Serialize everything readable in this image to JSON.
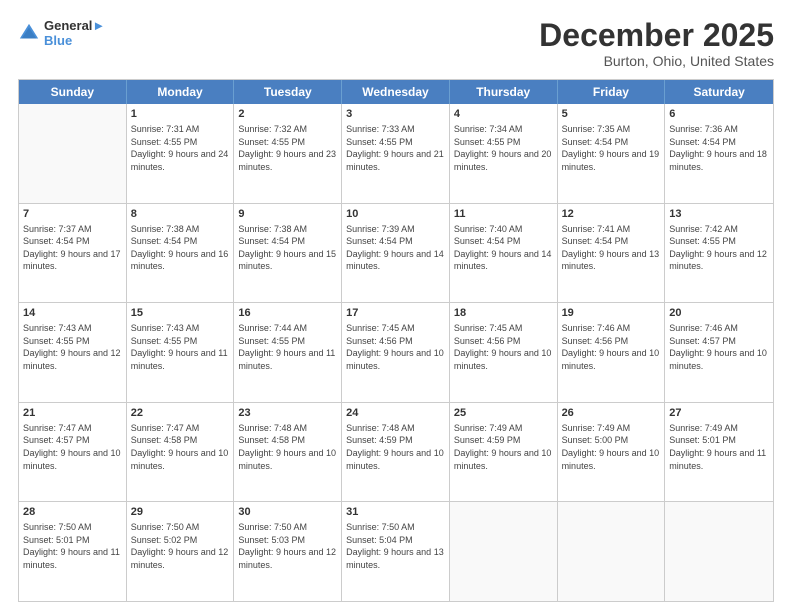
{
  "header": {
    "logo_line1": "General",
    "logo_line2": "Blue",
    "month": "December 2025",
    "location": "Burton, Ohio, United States"
  },
  "days_of_week": [
    "Sunday",
    "Monday",
    "Tuesday",
    "Wednesday",
    "Thursday",
    "Friday",
    "Saturday"
  ],
  "weeks": [
    [
      {
        "day": "",
        "sunrise": "",
        "sunset": "",
        "daylight": ""
      },
      {
        "day": "1",
        "sunrise": "Sunrise: 7:31 AM",
        "sunset": "Sunset: 4:55 PM",
        "daylight": "Daylight: 9 hours and 24 minutes."
      },
      {
        "day": "2",
        "sunrise": "Sunrise: 7:32 AM",
        "sunset": "Sunset: 4:55 PM",
        "daylight": "Daylight: 9 hours and 23 minutes."
      },
      {
        "day": "3",
        "sunrise": "Sunrise: 7:33 AM",
        "sunset": "Sunset: 4:55 PM",
        "daylight": "Daylight: 9 hours and 21 minutes."
      },
      {
        "day": "4",
        "sunrise": "Sunrise: 7:34 AM",
        "sunset": "Sunset: 4:55 PM",
        "daylight": "Daylight: 9 hours and 20 minutes."
      },
      {
        "day": "5",
        "sunrise": "Sunrise: 7:35 AM",
        "sunset": "Sunset: 4:54 PM",
        "daylight": "Daylight: 9 hours and 19 minutes."
      },
      {
        "day": "6",
        "sunrise": "Sunrise: 7:36 AM",
        "sunset": "Sunset: 4:54 PM",
        "daylight": "Daylight: 9 hours and 18 minutes."
      }
    ],
    [
      {
        "day": "7",
        "sunrise": "Sunrise: 7:37 AM",
        "sunset": "Sunset: 4:54 PM",
        "daylight": "Daylight: 9 hours and 17 minutes."
      },
      {
        "day": "8",
        "sunrise": "Sunrise: 7:38 AM",
        "sunset": "Sunset: 4:54 PM",
        "daylight": "Daylight: 9 hours and 16 minutes."
      },
      {
        "day": "9",
        "sunrise": "Sunrise: 7:38 AM",
        "sunset": "Sunset: 4:54 PM",
        "daylight": "Daylight: 9 hours and 15 minutes."
      },
      {
        "day": "10",
        "sunrise": "Sunrise: 7:39 AM",
        "sunset": "Sunset: 4:54 PM",
        "daylight": "Daylight: 9 hours and 14 minutes."
      },
      {
        "day": "11",
        "sunrise": "Sunrise: 7:40 AM",
        "sunset": "Sunset: 4:54 PM",
        "daylight": "Daylight: 9 hours and 14 minutes."
      },
      {
        "day": "12",
        "sunrise": "Sunrise: 7:41 AM",
        "sunset": "Sunset: 4:54 PM",
        "daylight": "Daylight: 9 hours and 13 minutes."
      },
      {
        "day": "13",
        "sunrise": "Sunrise: 7:42 AM",
        "sunset": "Sunset: 4:55 PM",
        "daylight": "Daylight: 9 hours and 12 minutes."
      }
    ],
    [
      {
        "day": "14",
        "sunrise": "Sunrise: 7:43 AM",
        "sunset": "Sunset: 4:55 PM",
        "daylight": "Daylight: 9 hours and 12 minutes."
      },
      {
        "day": "15",
        "sunrise": "Sunrise: 7:43 AM",
        "sunset": "Sunset: 4:55 PM",
        "daylight": "Daylight: 9 hours and 11 minutes."
      },
      {
        "day": "16",
        "sunrise": "Sunrise: 7:44 AM",
        "sunset": "Sunset: 4:55 PM",
        "daylight": "Daylight: 9 hours and 11 minutes."
      },
      {
        "day": "17",
        "sunrise": "Sunrise: 7:45 AM",
        "sunset": "Sunset: 4:56 PM",
        "daylight": "Daylight: 9 hours and 10 minutes."
      },
      {
        "day": "18",
        "sunrise": "Sunrise: 7:45 AM",
        "sunset": "Sunset: 4:56 PM",
        "daylight": "Daylight: 9 hours and 10 minutes."
      },
      {
        "day": "19",
        "sunrise": "Sunrise: 7:46 AM",
        "sunset": "Sunset: 4:56 PM",
        "daylight": "Daylight: 9 hours and 10 minutes."
      },
      {
        "day": "20",
        "sunrise": "Sunrise: 7:46 AM",
        "sunset": "Sunset: 4:57 PM",
        "daylight": "Daylight: 9 hours and 10 minutes."
      }
    ],
    [
      {
        "day": "21",
        "sunrise": "Sunrise: 7:47 AM",
        "sunset": "Sunset: 4:57 PM",
        "daylight": "Daylight: 9 hours and 10 minutes."
      },
      {
        "day": "22",
        "sunrise": "Sunrise: 7:47 AM",
        "sunset": "Sunset: 4:58 PM",
        "daylight": "Daylight: 9 hours and 10 minutes."
      },
      {
        "day": "23",
        "sunrise": "Sunrise: 7:48 AM",
        "sunset": "Sunset: 4:58 PM",
        "daylight": "Daylight: 9 hours and 10 minutes."
      },
      {
        "day": "24",
        "sunrise": "Sunrise: 7:48 AM",
        "sunset": "Sunset: 4:59 PM",
        "daylight": "Daylight: 9 hours and 10 minutes."
      },
      {
        "day": "25",
        "sunrise": "Sunrise: 7:49 AM",
        "sunset": "Sunset: 4:59 PM",
        "daylight": "Daylight: 9 hours and 10 minutes."
      },
      {
        "day": "26",
        "sunrise": "Sunrise: 7:49 AM",
        "sunset": "Sunset: 5:00 PM",
        "daylight": "Daylight: 9 hours and 10 minutes."
      },
      {
        "day": "27",
        "sunrise": "Sunrise: 7:49 AM",
        "sunset": "Sunset: 5:01 PM",
        "daylight": "Daylight: 9 hours and 11 minutes."
      }
    ],
    [
      {
        "day": "28",
        "sunrise": "Sunrise: 7:50 AM",
        "sunset": "Sunset: 5:01 PM",
        "daylight": "Daylight: 9 hours and 11 minutes."
      },
      {
        "day": "29",
        "sunrise": "Sunrise: 7:50 AM",
        "sunset": "Sunset: 5:02 PM",
        "daylight": "Daylight: 9 hours and 12 minutes."
      },
      {
        "day": "30",
        "sunrise": "Sunrise: 7:50 AM",
        "sunset": "Sunset: 5:03 PM",
        "daylight": "Daylight: 9 hours and 12 minutes."
      },
      {
        "day": "31",
        "sunrise": "Sunrise: 7:50 AM",
        "sunset": "Sunset: 5:04 PM",
        "daylight": "Daylight: 9 hours and 13 minutes."
      },
      {
        "day": "",
        "sunrise": "",
        "sunset": "",
        "daylight": ""
      },
      {
        "day": "",
        "sunrise": "",
        "sunset": "",
        "daylight": ""
      },
      {
        "day": "",
        "sunrise": "",
        "sunset": "",
        "daylight": ""
      }
    ]
  ]
}
